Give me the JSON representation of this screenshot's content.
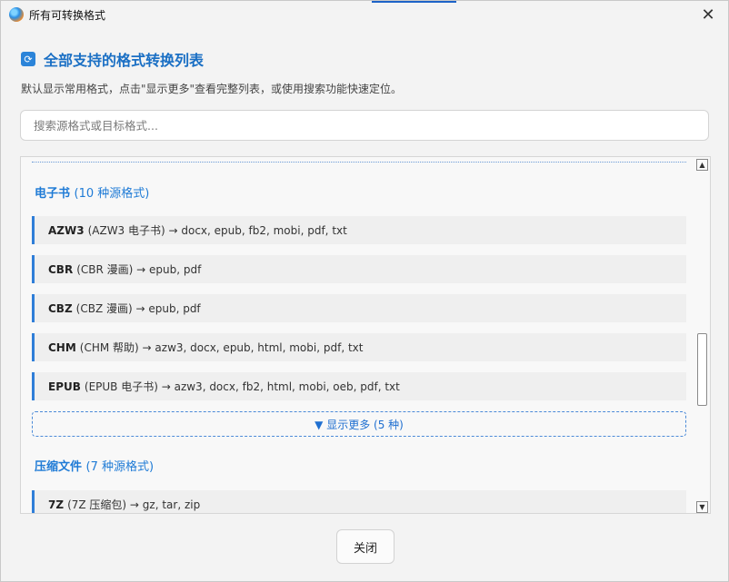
{
  "window": {
    "title": "所有可转换格式"
  },
  "header": {
    "icon": "refresh-icon",
    "title": "全部支持的格式转换列表",
    "subtitle": "默认显示常用格式，点击\"显示更多\"查看完整列表，或使用搜索功能快速定位。"
  },
  "search": {
    "placeholder": "搜索源格式或目标格式...",
    "value": ""
  },
  "categories": [
    {
      "name": "电子书",
      "count_text": "(10 种源格式)",
      "items": [
        {
          "format": "AZW3",
          "desc": "(AZW3 电子书) → docx, epub, fb2, mobi, pdf, txt"
        },
        {
          "format": "CBR",
          "desc": "(CBR 漫画) → epub, pdf"
        },
        {
          "format": "CBZ",
          "desc": "(CBZ 漫画) → epub, pdf"
        },
        {
          "format": "CHM",
          "desc": "(CHM 帮助) → azw3, docx, epub, html, mobi, pdf, txt"
        },
        {
          "format": "EPUB",
          "desc": "(EPUB 电子书) → azw3, docx, fb2, html, mobi, oeb, pdf, txt"
        }
      ],
      "show_more": "▼ 显示更多 (5 种)"
    },
    {
      "name": "压缩文件",
      "count_text": "(7 种源格式)",
      "items": [
        {
          "format": "7Z",
          "desc": "(7Z 压缩包) → gz, tar, zip"
        }
      ]
    }
  ],
  "footer": {
    "close_label": "关闭"
  },
  "colors": {
    "accent": "#1f7bd6",
    "row_border": "#2f7ed8"
  }
}
